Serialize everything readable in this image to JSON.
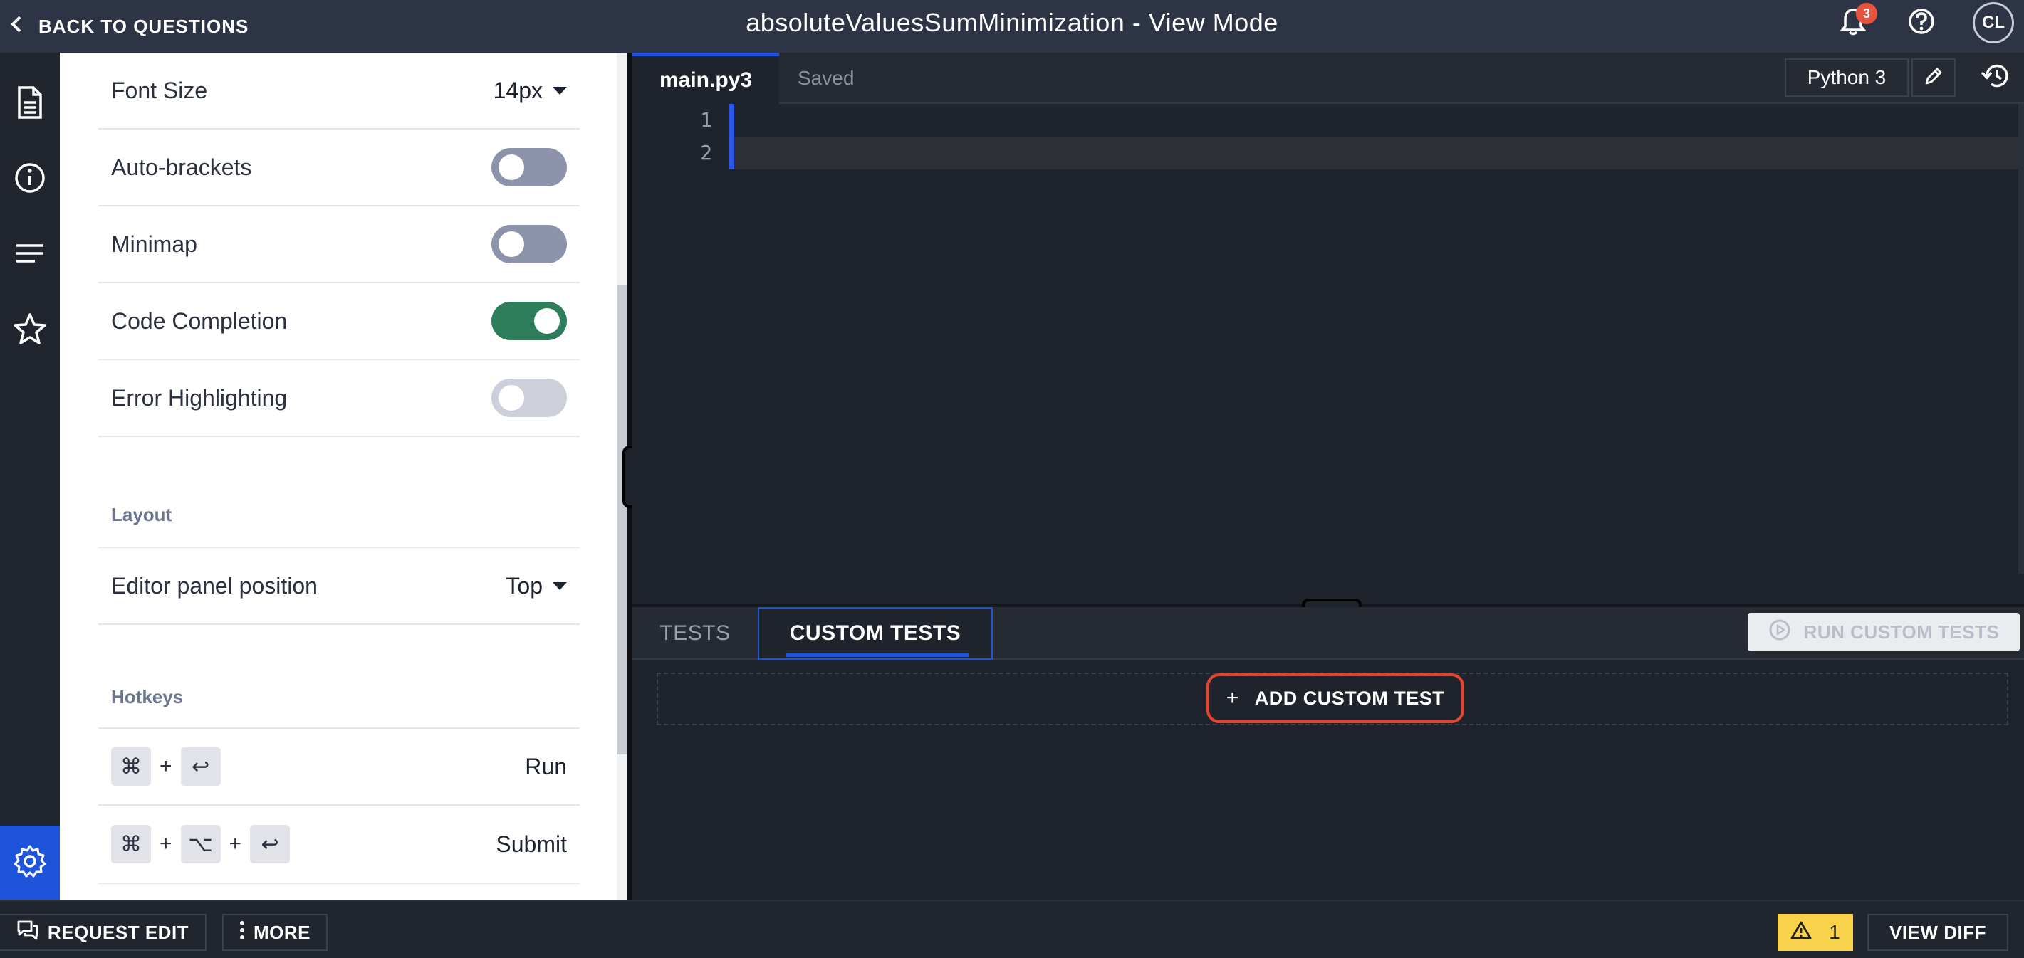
{
  "header": {
    "back_label": "BACK TO QUESTIONS",
    "title": "absoluteValuesSumMinimization - View Mode",
    "notification_count": "3",
    "avatar_initials": "CL"
  },
  "settings": {
    "font_size_label": "Font Size",
    "font_size_value": "14px",
    "toggles": [
      {
        "label": "Auto-brackets",
        "on": false
      },
      {
        "label": "Minimap",
        "on": false
      },
      {
        "label": "Code Completion",
        "on": true
      },
      {
        "label": "Error Highlighting",
        "on": false
      }
    ],
    "layout_heading": "Layout",
    "editor_panel_label": "Editor panel position",
    "editor_panel_value": "Top",
    "hotkeys_heading": "Hotkeys",
    "hotkeys": [
      {
        "keys": [
          "⌘",
          "↩"
        ],
        "action": "Run"
      },
      {
        "keys": [
          "⌘",
          "⌥",
          "↩"
        ],
        "action": "Submit"
      }
    ],
    "plus": "+"
  },
  "editor": {
    "file_tab": "main.py3",
    "status": "Saved",
    "language": "Python 3",
    "line_numbers": [
      "1",
      "2"
    ]
  },
  "tests": {
    "tab_tests": "TESTS",
    "tab_custom": "CUSTOM TESTS",
    "run_label": "RUN CUSTOM TESTS",
    "add_label": "ADD CUSTOM TEST",
    "add_plus": "+"
  },
  "footer": {
    "request_edit": "REQUEST EDIT",
    "more": "MORE",
    "warning_count": "1",
    "view_diff": "VIEW DIFF"
  },
  "colors": {
    "accent": "#1e54d9",
    "toggle_on": "#2e7d5b",
    "toggle_off": "#8d93aa",
    "toggle_off_light": "#cdd0da",
    "highlight_red": "#e5452f",
    "warning": "#f7d24a"
  }
}
